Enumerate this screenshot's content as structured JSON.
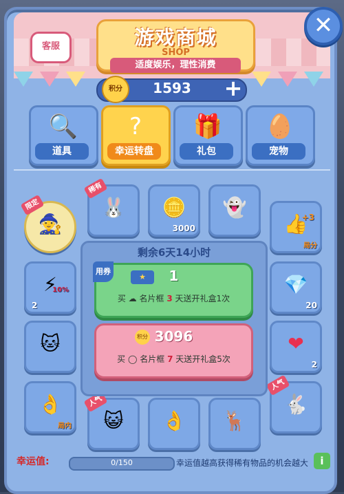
{
  "header": {
    "title_cn": "游戏商城",
    "title_en": "SHOP",
    "subtitle": "适度娱乐，理性消费",
    "service_label": "客服",
    "close_label": "✕"
  },
  "points": {
    "badge": "积分",
    "value": "1593",
    "plus": "+"
  },
  "tabs": [
    {
      "label": "道具",
      "icon": "🔍"
    },
    {
      "label": "幸运转盘",
      "icon": "?"
    },
    {
      "label": "礼包",
      "icon": "🎁"
    },
    {
      "label": "宠物",
      "icon": "🥚"
    }
  ],
  "slots": {
    "limited": {
      "tag": "限定",
      "icon": "🧙"
    },
    "rabbit": {
      "tag": "稀有",
      "icon": "🐰"
    },
    "coin": {
      "icon": "🪙",
      "count": "3000"
    },
    "ghost": {
      "icon": "👻"
    },
    "plus3": {
      "icon": "👍",
      "tag": "+3",
      "sub": "局分"
    },
    "lightning": {
      "icon": "⚡",
      "badge": "10%",
      "count": "2"
    },
    "diamond": {
      "icon": "💎",
      "count": "20"
    },
    "slime": {
      "icon": "🐱"
    },
    "heart": {
      "icon": "❤",
      "count": "2"
    },
    "ok_hand": {
      "icon": "👌",
      "sub": "局内"
    },
    "catmask": {
      "tag": "人气",
      "icon": "😺"
    },
    "handblue": {
      "icon": "👌"
    },
    "deer": {
      "icon": "🦌"
    },
    "bunny": {
      "tag": "人气",
      "icon": "🐇"
    }
  },
  "center": {
    "remaining": "剩余6天14小时",
    "ticket_card": {
      "tag": "用券",
      "ticket": "★",
      "value": "1",
      "desc_prefix": "买",
      "desc_mid": "名片框",
      "days": "3",
      "desc_suffix": "天送开礼盒1次"
    },
    "points_card": {
      "badge": "积分",
      "value": "3096",
      "desc_prefix": "买",
      "desc_mid": "名片框",
      "days": "7",
      "desc_suffix": "天送开礼盒5次"
    }
  },
  "luck": {
    "label": "幸运值:",
    "value": "0/150",
    "tip": "幸运值越高获得稀有物品的机会越大",
    "info": "i"
  }
}
